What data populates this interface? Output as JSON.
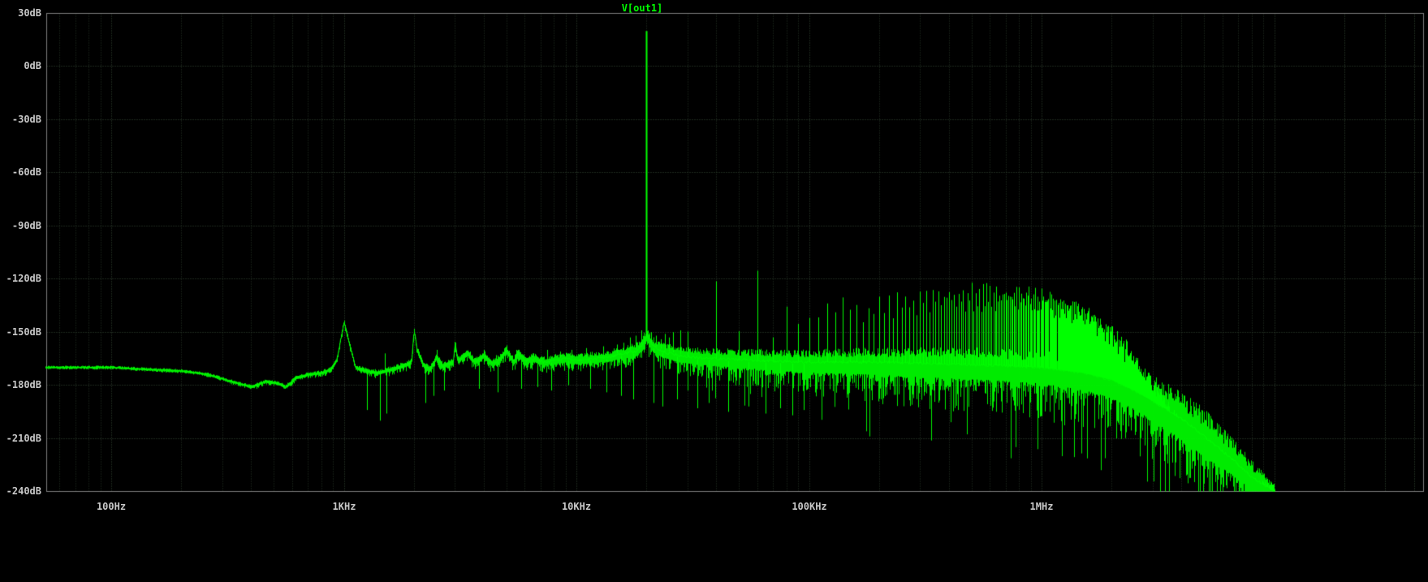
{
  "chart_data": {
    "type": "line",
    "title": "V[out1]",
    "series": [
      {
        "name": "V[out1]",
        "color": "#00ff00"
      }
    ],
    "background": "#000000",
    "label_color": "#c8c8c8",
    "grid": {
      "style": "dotted",
      "color_major": "#3a4f3a",
      "color_minor": "#283828",
      "border_color": "#7d7d7d"
    },
    "x_axis": {
      "scale": "log",
      "unit": "Hz",
      "min_hz": 52,
      "max_hz": 10000000,
      "ticks": [
        {
          "label": "100Hz",
          "hz": 100
        },
        {
          "label": "1KHz",
          "hz": 1000
        },
        {
          "label": "10KHz",
          "hz": 10000
        },
        {
          "label": "100KHz",
          "hz": 100000
        },
        {
          "label": "1MHz",
          "hz": 1000000
        }
      ]
    },
    "y_axis": {
      "unit": "dB",
      "max_db": 30,
      "min_db": -240,
      "step_db": 30,
      "ticks": [
        {
          "label": "30dB",
          "db": 30
        },
        {
          "label": "0dB",
          "db": 0
        },
        {
          "label": "-30dB",
          "db": -30
        },
        {
          "label": "-60dB",
          "db": -60
        },
        {
          "label": "-90dB",
          "db": -90
        },
        {
          "label": "-120dB",
          "db": -120
        },
        {
          "label": "-150dB",
          "db": -150
        },
        {
          "label": "-180dB",
          "db": -180
        },
        {
          "label": "-210dB",
          "db": -210
        },
        {
          "label": "-240dB",
          "db": -240
        }
      ]
    },
    "trace": {
      "fundamental": {
        "hz": 20000,
        "db": 20
      },
      "noise_floor_db": [
        [
          52,
          -170
        ],
        [
          100,
          -170
        ],
        [
          140,
          -171
        ],
        [
          200,
          -172
        ],
        [
          260,
          -174
        ],
        [
          330,
          -178
        ],
        [
          400,
          -181
        ],
        [
          460,
          -178
        ],
        [
          520,
          -179
        ],
        [
          560,
          -181
        ],
        [
          620,
          -176
        ],
        [
          700,
          -174
        ],
        [
          800,
          -173
        ],
        [
          880,
          -171
        ],
        [
          930,
          -166
        ],
        [
          1000,
          -144
        ],
        [
          1060,
          -158
        ],
        [
          1120,
          -170
        ],
        [
          1250,
          -172
        ],
        [
          1400,
          -173
        ],
        [
          1600,
          -171
        ],
        [
          1800,
          -169
        ],
        [
          1950,
          -167
        ],
        [
          2000,
          -149
        ],
        [
          2060,
          -160
        ],
        [
          2200,
          -169
        ],
        [
          2350,
          -171
        ],
        [
          2500,
          -164
        ],
        [
          2650,
          -169
        ],
        [
          2950,
          -167
        ],
        [
          3000,
          -156
        ],
        [
          3080,
          -166
        ],
        [
          3400,
          -162
        ],
        [
          3650,
          -167
        ],
        [
          4000,
          -163
        ],
        [
          4350,
          -168
        ],
        [
          4700,
          -165
        ],
        [
          5000,
          -160
        ],
        [
          5350,
          -167
        ],
        [
          5600,
          -162
        ],
        [
          6000,
          -166
        ],
        [
          6600,
          -165
        ],
        [
          7200,
          -167
        ],
        [
          8000,
          -166
        ],
        [
          9000,
          -165
        ],
        [
          10000,
          -166
        ],
        [
          12000,
          -165
        ],
        [
          14000,
          -164
        ],
        [
          16000,
          -162
        ],
        [
          18000,
          -161
        ],
        [
          19200,
          -157
        ],
        [
          20000,
          -152
        ],
        [
          21000,
          -157
        ],
        [
          22500,
          -160
        ],
        [
          25000,
          -162
        ],
        [
          30000,
          -164
        ],
        [
          40000,
          -165
        ],
        [
          60000,
          -166
        ],
        [
          100000,
          -167
        ],
        [
          200000,
          -167
        ],
        [
          400000,
          -168
        ],
        [
          700000,
          -169
        ],
        [
          1000000,
          -170
        ],
        [
          1500000,
          -173
        ],
        [
          2000000,
          -177
        ],
        [
          2500000,
          -183
        ],
        [
          3000000,
          -189
        ],
        [
          4000000,
          -199
        ],
        [
          5000000,
          -209
        ],
        [
          6500000,
          -221
        ],
        [
          8000000,
          -232
        ],
        [
          10000000,
          -240
        ]
      ],
      "noise_spread_db": [
        [
          52,
          1,
          1
        ],
        [
          300,
          1.2,
          1.5
        ],
        [
          800,
          1.5,
          2.5
        ],
        [
          1500,
          2,
          3.5
        ],
        [
          3000,
          2.5,
          5
        ],
        [
          6000,
          3,
          6
        ],
        [
          10000,
          4,
          7
        ],
        [
          15000,
          4.5,
          8
        ],
        [
          20000,
          5,
          10
        ],
        [
          40000,
          6,
          14
        ],
        [
          80000,
          7,
          18
        ],
        [
          150000,
          8,
          22
        ],
        [
          300000,
          9,
          26
        ],
        [
          600000,
          10,
          28
        ],
        [
          1000000,
          11,
          30
        ],
        [
          1500000,
          12,
          32
        ],
        [
          2000000,
          13,
          34
        ],
        [
          3000000,
          15,
          36
        ],
        [
          5000000,
          16,
          38
        ],
        [
          8000000,
          10,
          24
        ],
        [
          10000000,
          4,
          8
        ]
      ],
      "spurs_db": [
        [
          1500,
          -162
        ],
        [
          2500,
          -160
        ],
        [
          3500,
          -161
        ],
        [
          4000,
          -160
        ],
        [
          4500,
          -163
        ],
        [
          5000,
          -158
        ],
        [
          5500,
          -160
        ],
        [
          6500,
          -162
        ],
        [
          7500,
          -160
        ],
        [
          8500,
          -161
        ],
        [
          9500,
          -160
        ],
        [
          11000,
          -159
        ],
        [
          13000,
          -158
        ],
        [
          15000,
          -157
        ],
        [
          16000,
          -156
        ],
        [
          17000,
          -153
        ],
        [
          18000,
          -152
        ],
        [
          19000,
          -149
        ],
        [
          21000,
          -150
        ],
        [
          22000,
          -152
        ],
        [
          23000,
          -154
        ],
        [
          24000,
          -151
        ],
        [
          25000,
          -153
        ],
        [
          26000,
          -150
        ],
        [
          28000,
          -149
        ],
        [
          50000,
          -151
        ]
      ],
      "notches_db": [
        [
          420,
          -182
        ],
        [
          560,
          -181
        ],
        [
          1260,
          -194
        ],
        [
          1430,
          -200
        ],
        [
          1520,
          -196
        ],
        [
          2240,
          -190
        ],
        [
          2430,
          -186
        ],
        [
          2700,
          -183
        ],
        [
          3800,
          -182
        ],
        [
          4600,
          -184
        ],
        [
          5800,
          -182
        ],
        [
          6800,
          -181
        ],
        [
          7800,
          -183
        ],
        [
          9200,
          -180
        ],
        [
          11500,
          -182
        ],
        [
          13500,
          -184
        ],
        [
          15500,
          -186
        ],
        [
          17500,
          -188
        ],
        [
          21500,
          -190
        ],
        [
          23500,
          -192
        ],
        [
          27000,
          -188
        ],
        [
          33000,
          -193
        ],
        [
          37000,
          -190
        ],
        [
          45000,
          -195
        ],
        [
          55000,
          -192
        ],
        [
          65000,
          -196
        ],
        [
          75000,
          -193
        ],
        [
          85000,
          -197
        ],
        [
          95000,
          -194
        ]
      ],
      "harmonic_comb": {
        "fundamental_hz": 20000,
        "from_n": 2,
        "to_n": 500,
        "jitter_db": 4,
        "top_envelope_db": [
          [
            40000,
            -122
          ],
          [
            60000,
            -119
          ],
          [
            80000,
            -133
          ],
          [
            100000,
            -140
          ],
          [
            120000,
            -137
          ],
          [
            140000,
            -134
          ],
          [
            160000,
            -136
          ],
          [
            180000,
            -133
          ],
          [
            200000,
            -132
          ],
          [
            250000,
            -130
          ],
          [
            300000,
            -128
          ],
          [
            400000,
            -127
          ],
          [
            500000,
            -126
          ],
          [
            600000,
            -126
          ],
          [
            700000,
            -127
          ],
          [
            800000,
            -127
          ],
          [
            900000,
            -128
          ],
          [
            1000000,
            -129
          ],
          [
            1200000,
            -132
          ],
          [
            1400000,
            -136
          ],
          [
            1600000,
            -140
          ],
          [
            1800000,
            -145
          ],
          [
            2000000,
            -150
          ],
          [
            2300000,
            -158
          ],
          [
            2600000,
            -168
          ],
          [
            3000000,
            -180
          ],
          [
            3500000,
            -193
          ],
          [
            4000000,
            -203
          ],
          [
            5000000,
            -218
          ],
          [
            6000000,
            -228
          ],
          [
            8000000,
            -238
          ],
          [
            10000000,
            -240
          ]
        ]
      },
      "offset_comb": {
        "start_hz": 30000,
        "step_hz": 20000,
        "jitter_db": 5,
        "top_envelope_db": [
          [
            30000,
            -147
          ],
          [
            50000,
            -151
          ],
          [
            70000,
            -149
          ],
          [
            90000,
            -146
          ],
          [
            110000,
            -144
          ],
          [
            150000,
            -142
          ],
          [
            200000,
            -140
          ],
          [
            300000,
            -137
          ],
          [
            500000,
            -134
          ],
          [
            700000,
            -133
          ],
          [
            1000000,
            -135
          ],
          [
            1500000,
            -142
          ],
          [
            2000000,
            -155
          ],
          [
            3000000,
            -185
          ],
          [
            4000000,
            -205
          ],
          [
            5000000,
            -220
          ],
          [
            8000000,
            -238
          ],
          [
            10000000,
            -240
          ]
        ]
      }
    }
  }
}
